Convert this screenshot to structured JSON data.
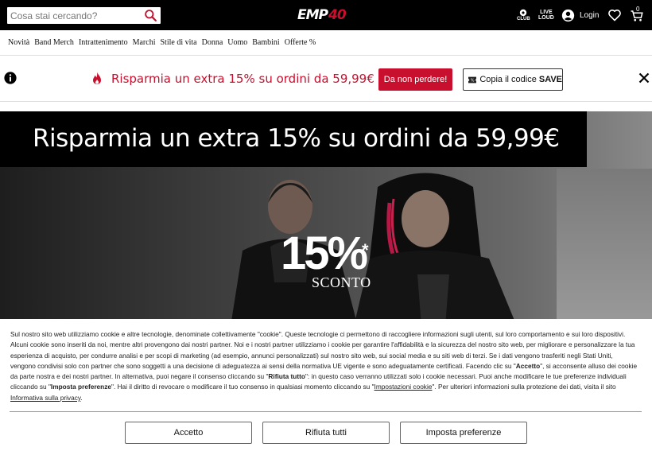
{
  "header": {
    "search_placeholder": "Cosa stai cercando?",
    "logo_main": "EMP",
    "logo_accent": "40",
    "club_label_top": "EMP",
    "club_label_bottom": "CLUB",
    "live_label_top": "LIVE",
    "live_label_bottom": "LOUD",
    "login_label": "Login",
    "cart_count": "0"
  },
  "nav": {
    "items": [
      "Novità",
      "Band Merch",
      "Intrattenimento",
      "Marchi",
      "Stile di vita",
      "Donna",
      "Uomo",
      "Bambini",
      "Offerte %"
    ]
  },
  "promo": {
    "text": "Risparmia un extra 15% su ordini da 59,99€",
    "cta_label": "Da non perdere!",
    "code_prefix": "Copia il codice",
    "code_value": "SAVE"
  },
  "hero": {
    "title": "Risparmia un extra 15% su ordini da 59,99€",
    "percent": "15%",
    "asterisk": "*",
    "discount_label": "SCONTO"
  },
  "cookie": {
    "p1": "Sul nostro sito web utilizziamo cookie e altre tecnologie, denominate collettivamente \"cookie\". Queste tecnologie ci permettono di raccogliere informazioni sugli utenti, sul loro comportamento e sui loro dispositivi. Alcuni cookie sono inseriti da noi, mentre altri provengono dai nostri partner. Noi e i nostri partner utilizziamo i cookie per garantire l'affidabilità e la sicurezza del nostro sito web, per migliorare e personalizzare la tua esperienza di acquisto, per condurre analisi e per scopi di marketing (ad esempio, annunci personalizzati) sul nostro sito web, sui social media e su siti web di terzi. Se i dati vengono trasferiti negli Stati Uniti, vengono condivisi solo con partner che sono soggetti a una decisione di adeguatezza ai sensi della normativa UE vigente e sono adeguatamente certificati. Facendo clic su \"",
    "accetto_inline": "Accetto",
    "p2": "\", si acconsente alluso dei cookie da parte nostra e dei nostri partner. In alternativa, puoi negare il consenso cliccando su \"",
    "rifiuta_inline": "Rifiuta tutto",
    "p3": "\": in questo caso verranno utilizzati solo i cookie necessari. Puoi anche modificare le tue preferenze individuali cliccando su \"",
    "imposta_inline": "Imposta preferenze",
    "p4": "\". Hai il diritto di revocare o modificare il tuo consenso in qualsiasi momento cliccando su \"",
    "impostazioni_link": "Impostazioni cookie",
    "p5": "\". Per ulteriori informazioni sulla protezione dei dati, visita il sito ",
    "privacy_link": "Informativa sulla privacy",
    "p6": ".",
    "btn_accept": "Accetto",
    "btn_reject": "Rifiuta tutti",
    "btn_prefs": "Imposta preferenze"
  },
  "colors": {
    "brand_red": "#c8102e",
    "topbar_bg": "#000000"
  },
  "icons": [
    "search-icon",
    "club-icon",
    "live-loud-icon",
    "user-icon",
    "heart-icon",
    "cart-icon",
    "info-icon",
    "fire-icon",
    "ticket-icon",
    "close-icon"
  ]
}
